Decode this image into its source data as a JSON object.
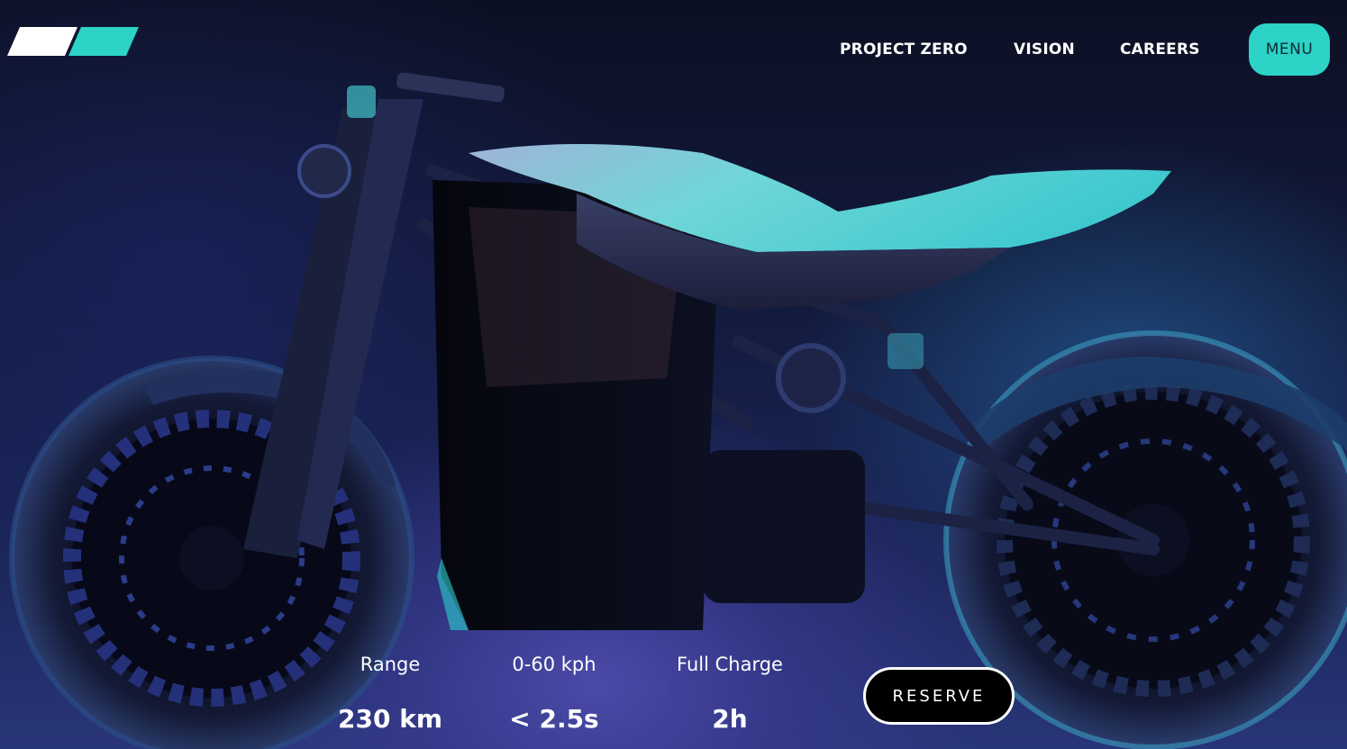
{
  "nav": {
    "links": [
      {
        "label": "PROJECT ZERO"
      },
      {
        "label": "VISION"
      },
      {
        "label": "CAREERS"
      }
    ],
    "menu_label": "MENU"
  },
  "brand": {
    "logo_icon": "twin-parallelogram-logo-icon",
    "accent_color": "#2cd3c6",
    "logo_white": "#ffffff"
  },
  "hero": {
    "image": "electric-motorcycle-image"
  },
  "specs": [
    {
      "label": "Range",
      "value": "230 km"
    },
    {
      "label": "0-60 kph",
      "value": "< 2.5s"
    },
    {
      "label": "Full Charge",
      "value": "2h"
    }
  ],
  "cta": {
    "reserve_label": "RESERVE"
  }
}
